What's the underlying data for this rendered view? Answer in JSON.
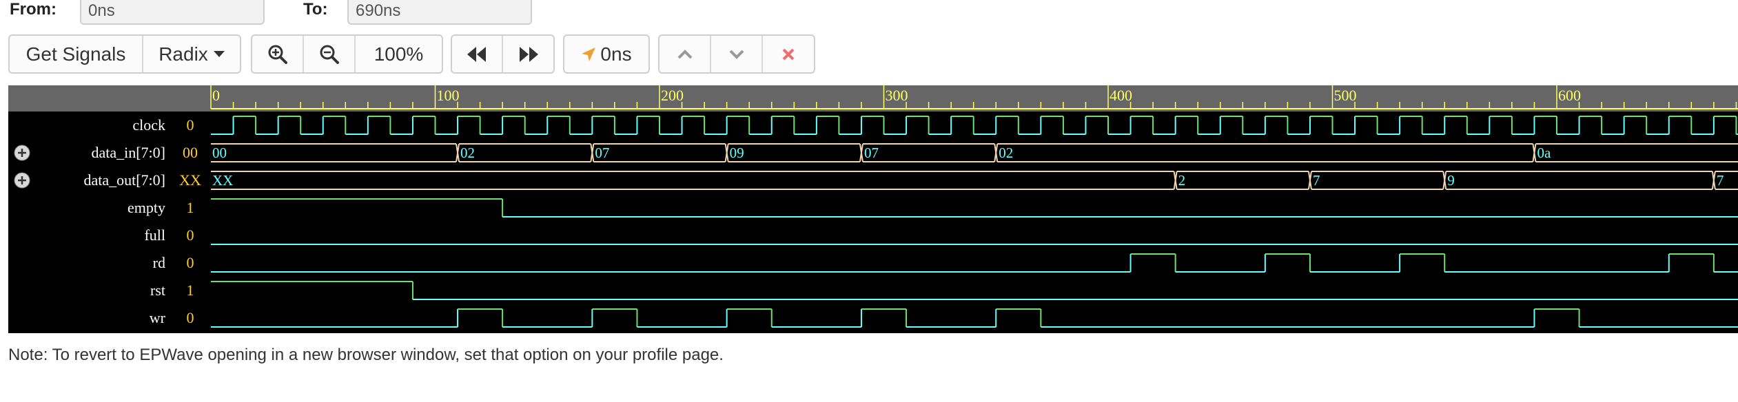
{
  "range": {
    "from_label": "From:",
    "from_value": "0ns",
    "to_label": "To:",
    "to_value": "690ns"
  },
  "toolbar": {
    "get_signals_label": "Get Signals",
    "radix_label": "Radix",
    "zoom_in_icon": "zoom-in-icon",
    "zoom_out_icon": "zoom-out-icon",
    "zoom_level": "100%",
    "rewind_icon": "rewind-icon",
    "fast_forward_icon": "fast-forward-icon",
    "cursor_time": "0ns",
    "up_icon": "chevron-up-icon",
    "down_icon": "chevron-down-icon",
    "close_icon": "close-icon"
  },
  "colors": {
    "ruler_bg": "#666666",
    "ruler_line": "#ffff66",
    "wave_bg": "#000000",
    "signal_high": "#6ce26c",
    "signal_low": "#66ffff",
    "bus_line": "#f0d5b0",
    "bus_text": "#66ffff",
    "value_text": "#ffcc33",
    "name_text": "#ffffff",
    "close_red": "#f26c6c",
    "cursor_orange": "#f0a030"
  },
  "timeline": {
    "start": 0,
    "end": 690,
    "major_tick_labels": [
      "0",
      "100",
      "200",
      "300",
      "400",
      "500",
      "600"
    ]
  },
  "signals": [
    {
      "name": "clock",
      "value": "0",
      "type": "clock",
      "period": 20,
      "first_rise": 10
    },
    {
      "name": "data_in[7:0]",
      "value": "00",
      "type": "bus",
      "expandable": true,
      "segments": [
        {
          "t": 0,
          "label": "00"
        },
        {
          "t": 110,
          "label": "02"
        },
        {
          "t": 170,
          "label": "07"
        },
        {
          "t": 230,
          "label": "09"
        },
        {
          "t": 290,
          "label": "07"
        },
        {
          "t": 350,
          "label": "02"
        },
        {
          "t": 590,
          "label": "0a"
        }
      ]
    },
    {
      "name": "data_out[7:0]",
      "value": "XX",
      "type": "bus",
      "expandable": true,
      "segments": [
        {
          "t": 0,
          "label": "XX"
        },
        {
          "t": 430,
          "label": "2"
        },
        {
          "t": 490,
          "label": "7"
        },
        {
          "t": 550,
          "label": "9"
        },
        {
          "t": 670,
          "label": "7"
        }
      ]
    },
    {
      "name": "empty",
      "value": "1",
      "type": "bit",
      "initial": 1,
      "transitions": [
        130
      ]
    },
    {
      "name": "full",
      "value": "0",
      "type": "bit",
      "initial": 0,
      "transitions": []
    },
    {
      "name": "rd",
      "value": "0",
      "type": "bit",
      "initial": 0,
      "transitions": [
        410,
        430,
        470,
        490,
        530,
        550,
        650,
        670
      ]
    },
    {
      "name": "rst",
      "value": "1",
      "type": "bit",
      "initial": 1,
      "transitions": [
        90
      ]
    },
    {
      "name": "wr",
      "value": "0",
      "type": "bit",
      "initial": 0,
      "transitions": [
        110,
        130,
        170,
        190,
        230,
        250,
        290,
        310,
        350,
        370,
        590,
        610
      ]
    }
  ],
  "note": "Note: To revert to EPWave opening in a new browser window, set that option on your profile page."
}
